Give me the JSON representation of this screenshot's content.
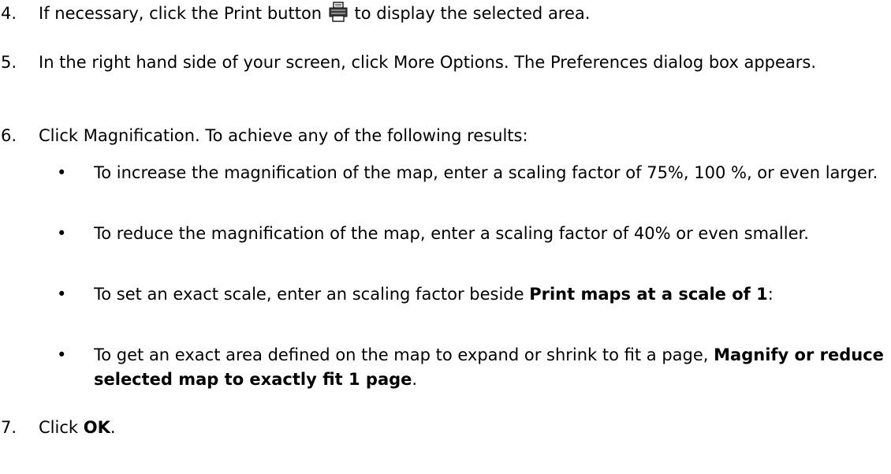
{
  "steps": [
    {
      "number": "4.",
      "text_before_icon": "If necessary, click the Print button",
      "icon": "printer-icon",
      "text_after_icon": "to display the selected area."
    },
    {
      "number": "5.",
      "text": "In the right hand side of your screen, click More Options. The Preferences dialog box appears."
    },
    {
      "number": "6.",
      "text": "Click Magnification. To achieve any of the following results:",
      "bullets": [
        {
          "bullet": "•",
          "text": "To increase the magnification of the map, enter a scaling factor of 75%, 100 %, or even larger."
        },
        {
          "bullet": "•",
          "text": "To reduce the magnification of the map, enter a scaling factor of 40% or even smaller."
        },
        {
          "bullet": "•",
          "text_before_bold": "To set an exact scale, enter an scaling factor beside ",
          "bold": "Print maps at a scale of 1",
          "text_after_bold": ":"
        },
        {
          "bullet": "•",
          "text_before_bold": "To get an exact area defined on the map to expand or shrink to fit a page, ",
          "bold": "Magnify or reduce selected map to exactly fit 1 page",
          "text_after_bold": "."
        }
      ]
    },
    {
      "number": "7.",
      "text_before_bold": "Click ",
      "bold": "OK",
      "text_after_bold": "."
    }
  ]
}
